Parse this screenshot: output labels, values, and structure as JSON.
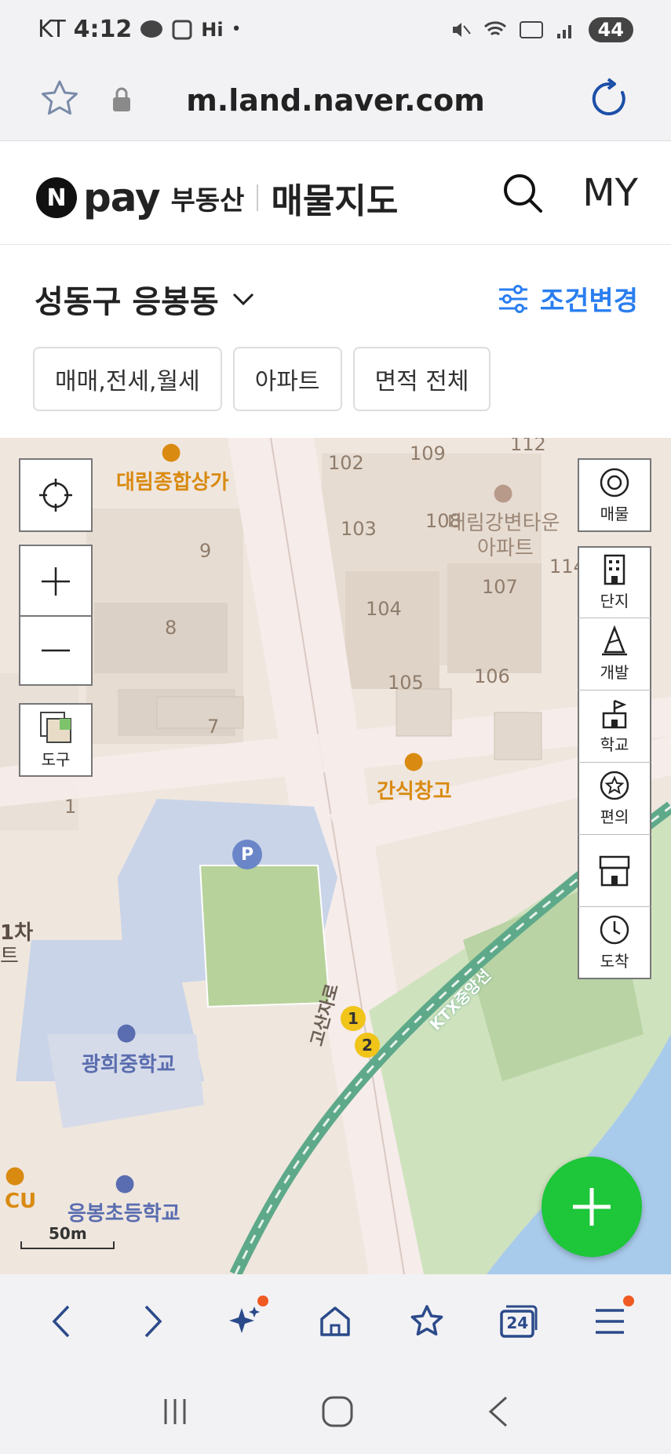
{
  "status_bar": {
    "carrier": "KT",
    "time": "4:12",
    "hi": "Hi",
    "battery": "44"
  },
  "url_bar": {
    "url": "m.land.naver.com"
  },
  "header": {
    "logo_n": "N",
    "pay": "pay",
    "budongsan": "부동산",
    "title": "매물지도",
    "my": "MY"
  },
  "filter": {
    "region": "성동구 응봉동",
    "condition_button": "조건변경",
    "chips": [
      "매매,전세,월세",
      "아파트",
      "면적 전체"
    ]
  },
  "map": {
    "labels": {
      "daelim_mall": "대림종합상가",
      "daelim_apt_line1": "대림강변타운",
      "daelim_apt_line2": "아파트",
      "gansik": "간식창고",
      "gwanghui": "광희중학교",
      "eungbong": "응봉초등학교",
      "cu": "CU",
      "goshanja": "고산자로",
      "ktx": "KTX중앙선",
      "onecha": "1차",
      "te": "트",
      "parking": "P",
      "bldg_102": "102",
      "bldg_109": "109",
      "bldg_112": "112",
      "bldg_103": "103",
      "bldg_108": "108",
      "bldg_107": "107",
      "bldg_114": "114",
      "bldg_104": "104",
      "bldg_105": "105",
      "bldg_106": "106",
      "bldg_9": "9",
      "bldg_8": "8",
      "bldg_7": "7",
      "bldg_1": "1",
      "exit_1": "1",
      "exit_2": "2"
    },
    "left_controls": {
      "tool": "도구"
    },
    "right_controls": [
      "매물",
      "단지",
      "개발",
      "학교",
      "편의",
      "중개",
      "도착"
    ],
    "scale": "50m",
    "colors": {
      "accent_blue": "#2a7ef0",
      "fab_green": "#1ec63a",
      "poi_orange": "#d98a10",
      "poi_blue": "#5a6db0",
      "rail_green": "#5ea98a",
      "water": "#a9cbeb"
    }
  },
  "browser_nav": {
    "tab_count": "24"
  }
}
